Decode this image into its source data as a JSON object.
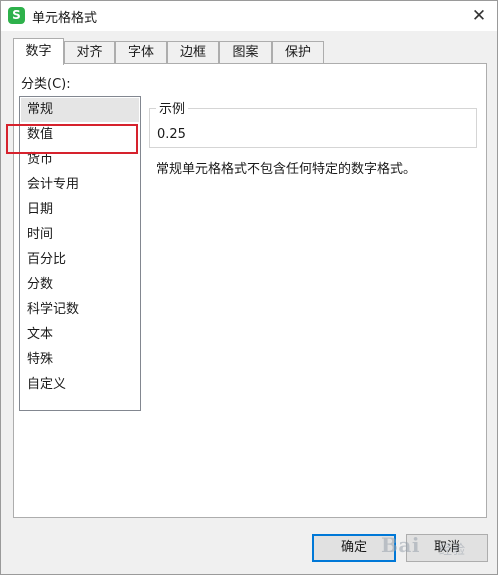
{
  "window": {
    "title": "单元格格式",
    "app_icon_letter": "S",
    "close_glyph": "✕"
  },
  "tabs": [
    {
      "label": "数字",
      "active": true
    },
    {
      "label": "对齐"
    },
    {
      "label": "字体"
    },
    {
      "label": "边框"
    },
    {
      "label": "图案"
    },
    {
      "label": "保护"
    }
  ],
  "category": {
    "label": "分类(C):",
    "items": [
      "常规",
      "数值",
      "货币",
      "会计专用",
      "日期",
      "时间",
      "百分比",
      "分数",
      "科学记数",
      "文本",
      "特殊",
      "自定义"
    ],
    "selected": "常规"
  },
  "sample": {
    "label": "示例",
    "value": "0.25"
  },
  "description": "常规单元格格式不包含任何特定的数字格式。",
  "buttons": {
    "ok": "确定",
    "cancel": "取消"
  },
  "watermark": {
    "text": "Bai",
    "sub": "经验"
  },
  "colors": {
    "highlight": "#d6222d",
    "app_icon": "#2eb14b",
    "default_button_border": "#0078d7"
  }
}
